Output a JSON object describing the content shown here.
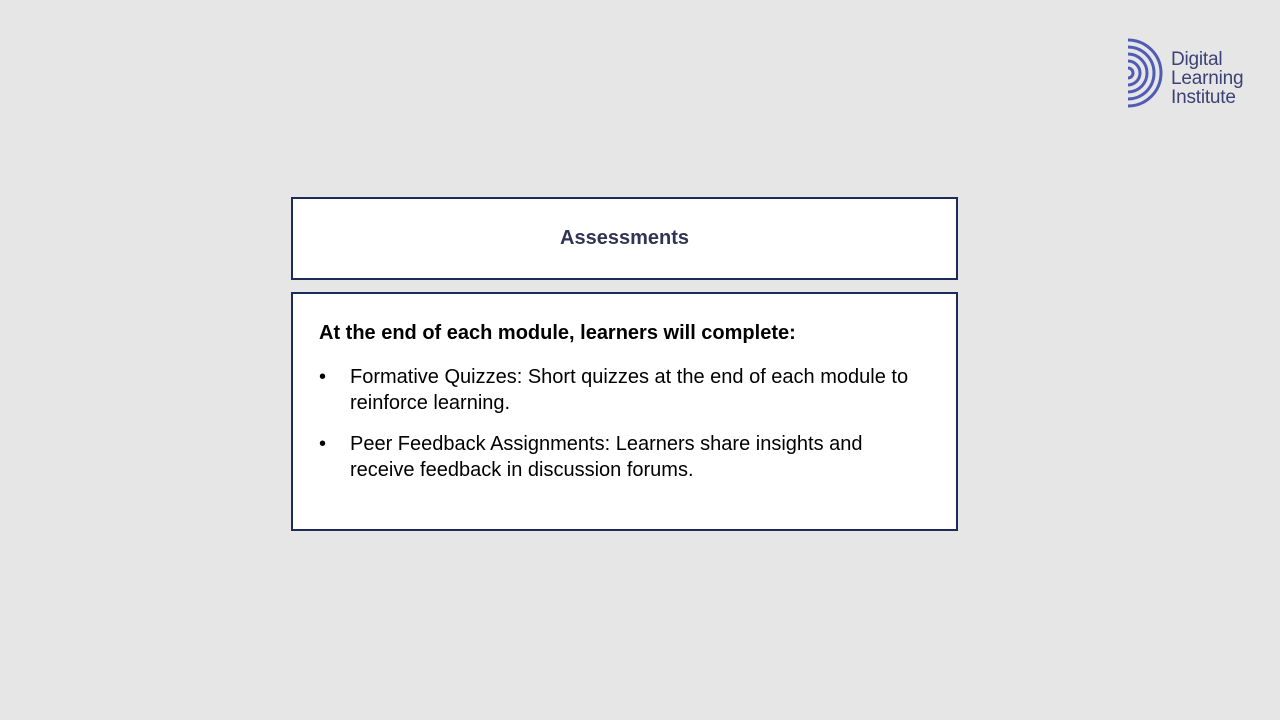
{
  "logo": {
    "lines": [
      "Digital",
      "Learning",
      "Institute"
    ],
    "color": "#3d4175",
    "mark_color": "#4f5bb5"
  },
  "title": "Assessments",
  "content": {
    "intro": "At the end of each module, learners will complete:",
    "bullets": [
      {
        "marker": "•",
        "text": "Formative Quizzes: Short quizzes at the end of each module to reinforce learning."
      },
      {
        "marker": "•",
        "text": "Peer Feedback Assignments: Learners share insights and receive feedback in discussion forums."
      }
    ]
  },
  "colors": {
    "background": "#e6e6e6",
    "box_border": "#1f2a5c",
    "title_text": "#333355"
  }
}
